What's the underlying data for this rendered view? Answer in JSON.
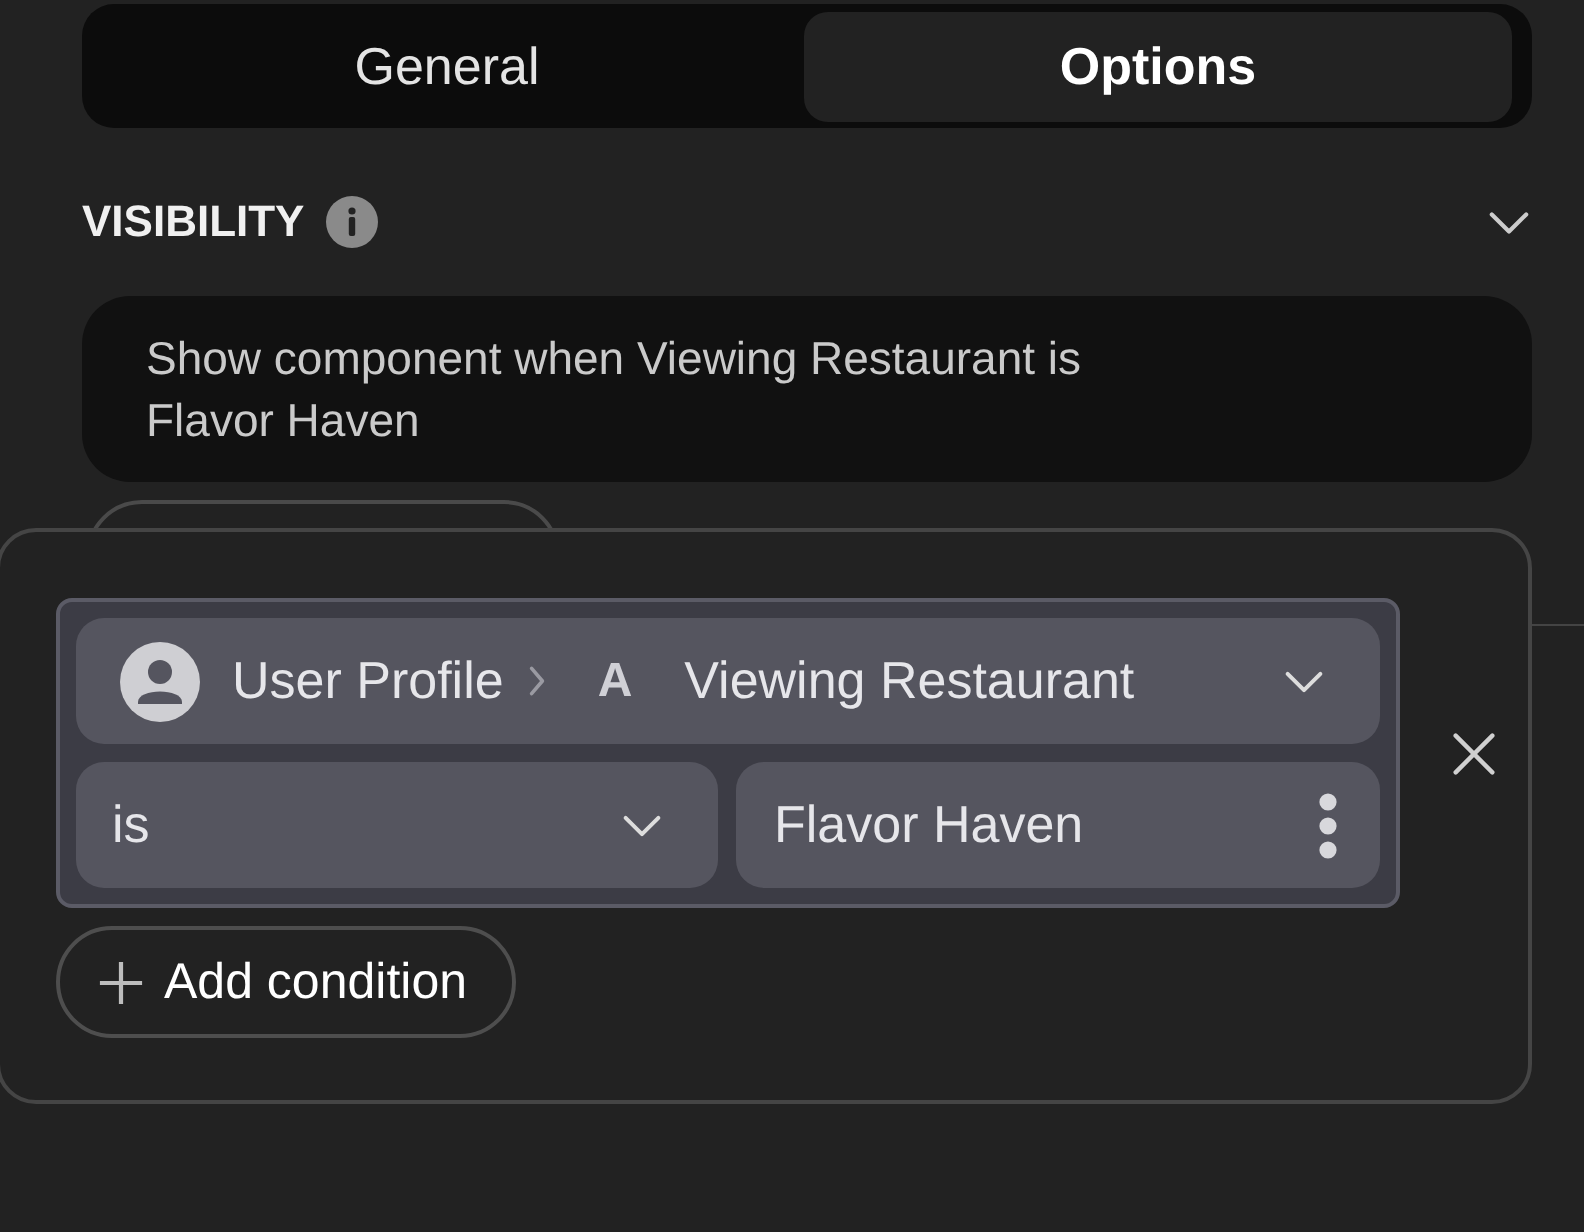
{
  "tabs": [
    {
      "label": "General",
      "selected": false
    },
    {
      "label": "Options",
      "selected": true
    }
  ],
  "section": {
    "title": "VISIBILITY",
    "expanded": true
  },
  "summary": "Show component when Viewing Restaurant is Flavor Haven",
  "popover": {
    "conditions": [
      {
        "source": "User Profile",
        "type_glyph": "A",
        "field": "Viewing Restaurant",
        "operator": "is",
        "value": "Flavor Haven"
      }
    ],
    "add_label": "Add condition"
  }
}
